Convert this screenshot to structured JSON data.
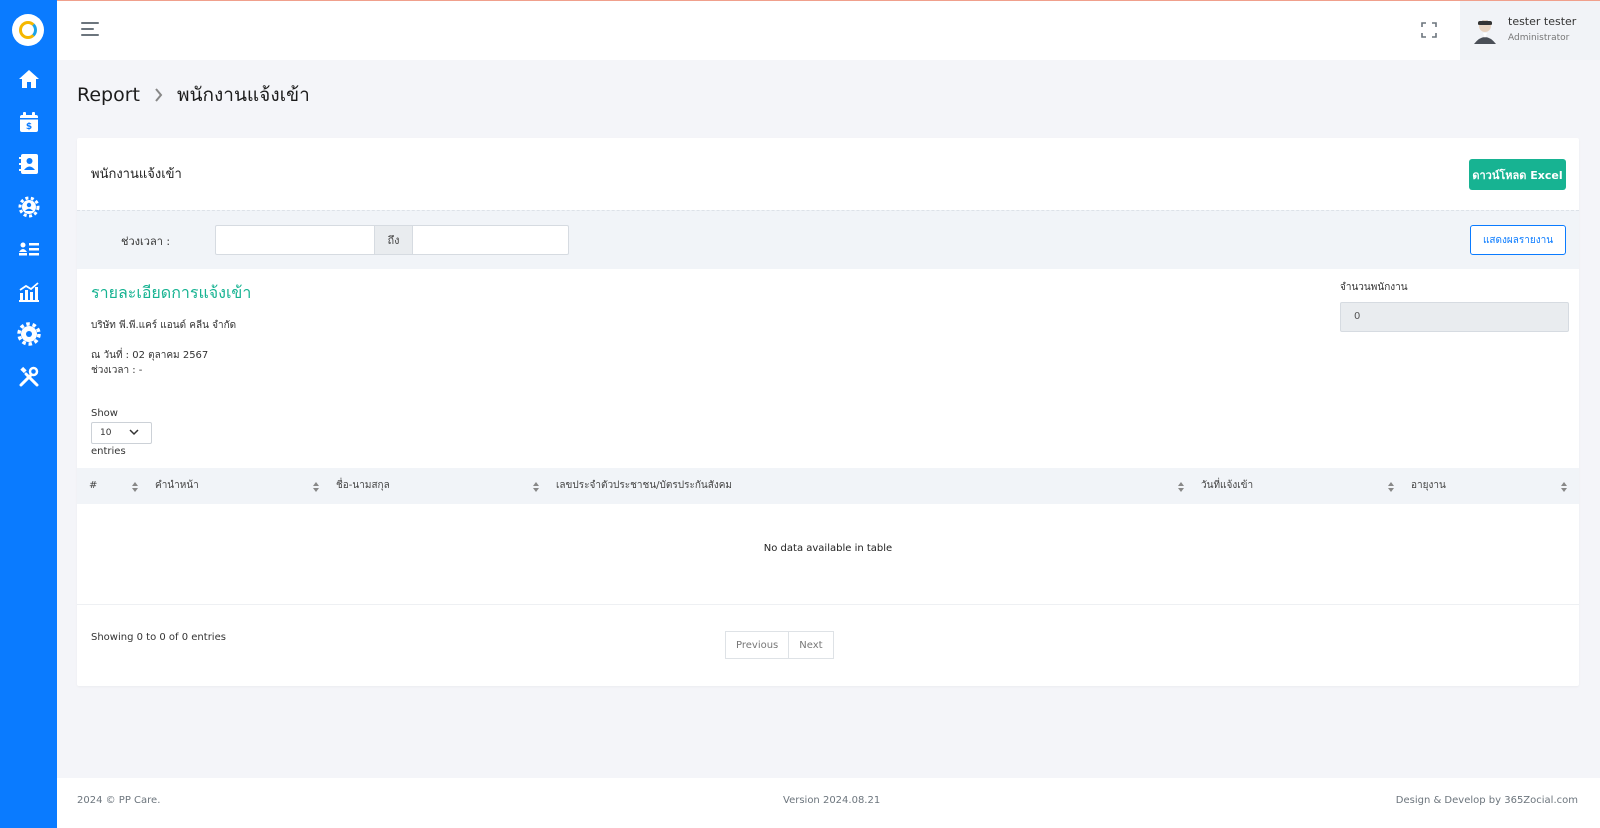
{
  "topbar": {
    "user_name": "tester tester",
    "user_role": "Administrator"
  },
  "breadcrumb": {
    "root": "Report",
    "current": "พนักงานแจ้งเข้า"
  },
  "card": {
    "title": "พนักงานแจ้งเข้า",
    "excel_button": "ดาวน์โหลด Excel"
  },
  "filter": {
    "period_label": "ช่วงเวลา :",
    "start_value": "",
    "to_label": "ถึง",
    "end_value": "",
    "show_button": "แสดงผลรายงาน"
  },
  "report": {
    "title": "รายละเอียดการแจ้งเข้า",
    "company": "บริษัท พี.พี.แคร์ แอนด์ คลีน จำกัด",
    "as_of": "ณ วันที่ : 02 ตุลาคม 2567",
    "period": "ช่วงเวลา : -",
    "employee_count_label": "จำนวนพนักงาน",
    "employee_count": "0"
  },
  "table": {
    "show_label": "Show",
    "page_size": "10",
    "entries_label": "entries",
    "columns": [
      "#",
      "คำนำหน้า",
      "ชื่อ-นามสกุล",
      "เลขประจำตัวประชาชน/บัตรประกันสังคม",
      "วันที่แจ้งเข้า",
      "อายุงาน"
    ],
    "empty_message": "No data available in table",
    "info": "Showing 0 to 0 of 0 entries",
    "prev": "Previous",
    "next": "Next"
  },
  "footer": {
    "copyright": "2024 © PP Care.",
    "version": "Version 2024.08.21",
    "credit": "Design & Develop by 365Zocial.com"
  },
  "colors": {
    "sidebar": "#0a7bff",
    "accent_green": "#17b392",
    "primary_blue": "#0a7bff"
  },
  "sidebar_icons": [
    "home-icon",
    "calendar-dollar-icon",
    "contact-book-icon",
    "users-cog-icon",
    "user-list-icon",
    "chart-bar-icon",
    "settings-icon",
    "tools-icon"
  ]
}
